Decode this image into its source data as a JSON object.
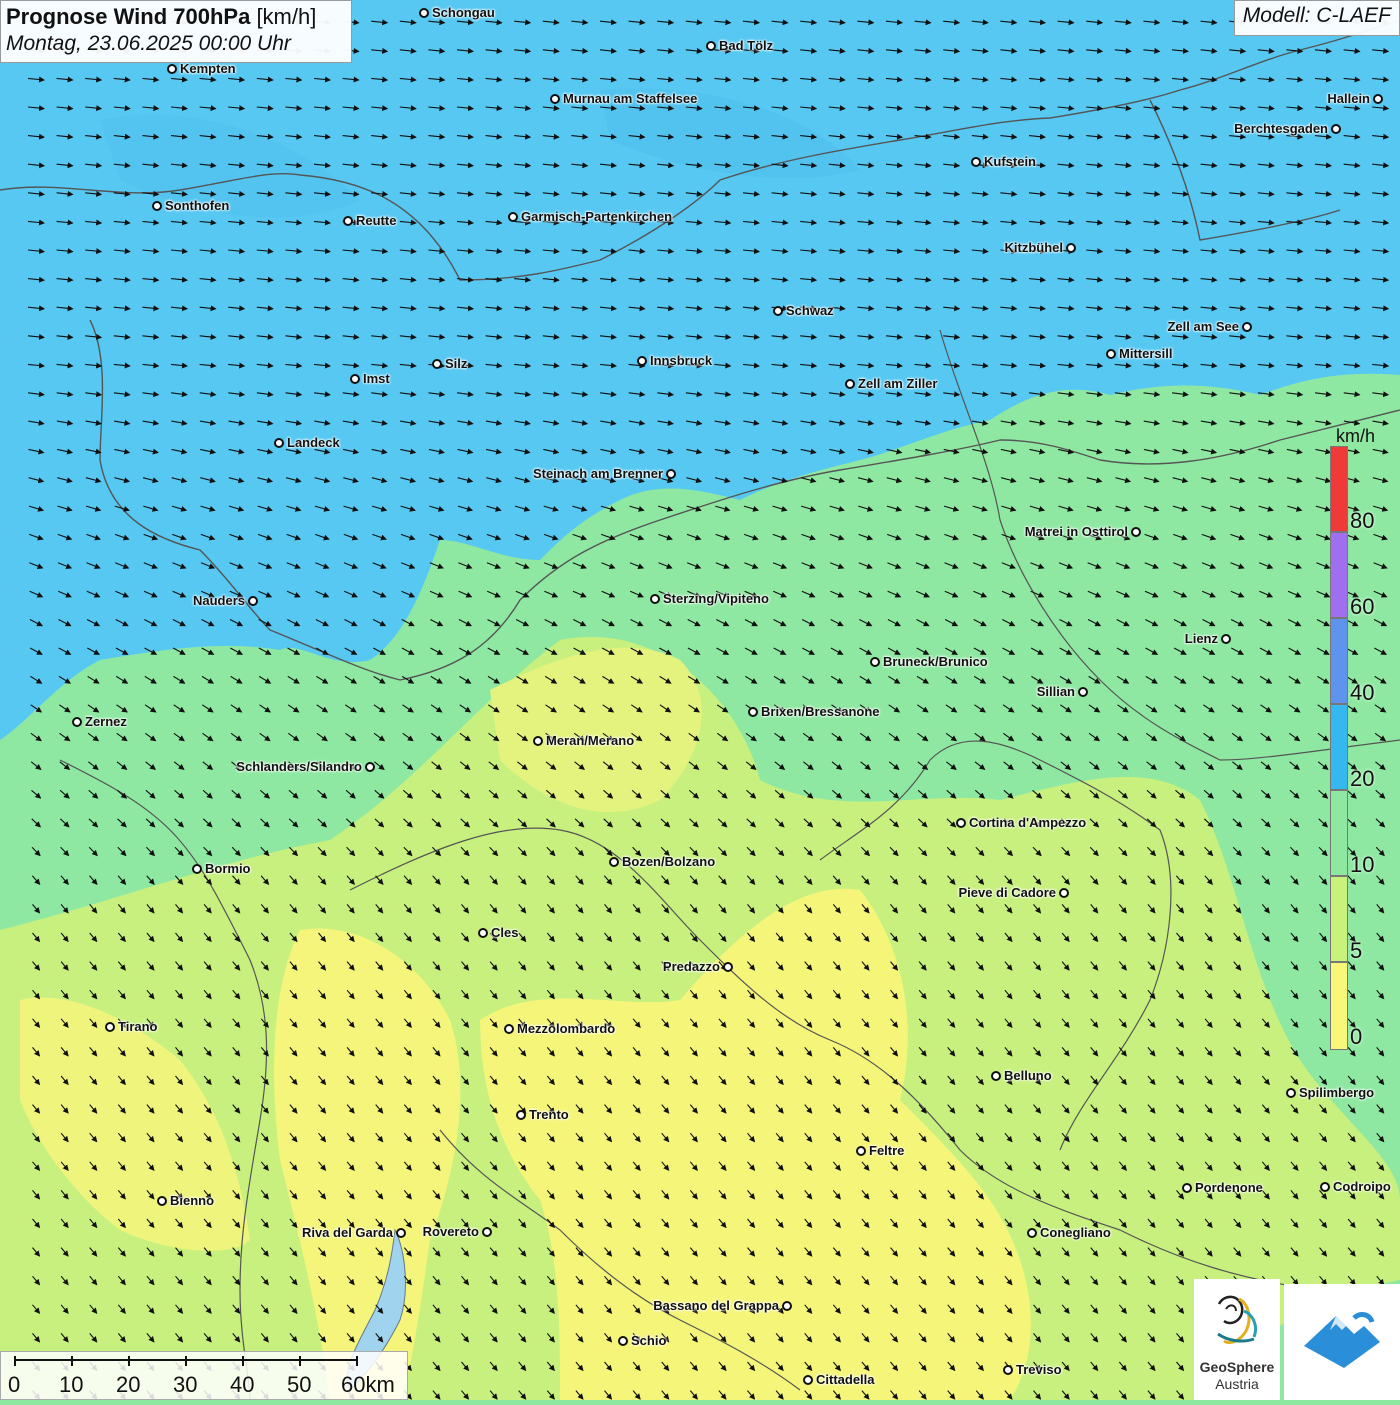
{
  "title": {
    "main_bold": "Prognose Wind 700hPa",
    "unit": "[km/h]",
    "datetime": "Montag, 23.06.2025 00:00 Uhr"
  },
  "model": "Modell: C-LAEF",
  "wind_arrow_direction": "WNW-NW wind; arrows point east in north, southeast in south",
  "colors": {
    "band_0_5": "#f7f77a",
    "band_5_10": "#c9f27c",
    "band_10_20": "#8fe8a2",
    "band_20_40": "#56c8f2",
    "band_40_60": "#5f94ee",
    "band_60_80": "#9f6ff0",
    "band_80_plus": "#f03a3a"
  },
  "legend": {
    "unit": "km/h",
    "ticks": [
      "80",
      "60",
      "40",
      "20",
      "10",
      "5",
      "0"
    ]
  },
  "scale": {
    "labels": [
      "0",
      "10",
      "20",
      "30",
      "40",
      "50",
      "60km"
    ]
  },
  "cities": [
    {
      "name": "Schongau"
    },
    {
      "name": "Bad Tölz"
    },
    {
      "name": "Kempten"
    },
    {
      "name": "Hallein"
    },
    {
      "name": "Murnau am Staffelsee"
    },
    {
      "name": "Berchtesgaden"
    },
    {
      "name": "Kufstein"
    },
    {
      "name": "Sonthofen"
    },
    {
      "name": "Reutte"
    },
    {
      "name": "Garmisch-Partenkirchen"
    },
    {
      "name": "Kitzbühel"
    },
    {
      "name": "Schwaz"
    },
    {
      "name": "Zell am See"
    },
    {
      "name": "Mittersill"
    },
    {
      "name": "Innsbruck"
    },
    {
      "name": "Silz"
    },
    {
      "name": "Imst"
    },
    {
      "name": "Zell am Ziller"
    },
    {
      "name": "Landeck"
    },
    {
      "name": "Steinach am Brenner"
    },
    {
      "name": "Matrei in Osttirol"
    },
    {
      "name": "Nauders"
    },
    {
      "name": "Sterzing/Vipiteno"
    },
    {
      "name": "Lienz"
    },
    {
      "name": "Bruneck/Brunico"
    },
    {
      "name": "Sillian"
    },
    {
      "name": "Brixen/Bressanone"
    },
    {
      "name": "Zernez"
    },
    {
      "name": "Meran/Merano"
    },
    {
      "name": "Schlanders/Silandro"
    },
    {
      "name": "Cortina d'Ampezzo"
    },
    {
      "name": "Bozen/Bolzano"
    },
    {
      "name": "Bormio"
    },
    {
      "name": "Pieve di Cadore"
    },
    {
      "name": "Cles"
    },
    {
      "name": "Predazzo"
    },
    {
      "name": "Tirano"
    },
    {
      "name": "Mezzolombardo"
    },
    {
      "name": "Belluno"
    },
    {
      "name": "Spilimbergo"
    },
    {
      "name": "Trento"
    },
    {
      "name": "Feltre"
    },
    {
      "name": "Pordenone"
    },
    {
      "name": "Codroipo"
    },
    {
      "name": "Bienno"
    },
    {
      "name": "Riva del Garda"
    },
    {
      "name": "Rovereto"
    },
    {
      "name": "Conegliano"
    },
    {
      "name": "Bassano del Grappa"
    },
    {
      "name": "Schio"
    },
    {
      "name": "Treviso"
    },
    {
      "name": "Cittadella"
    }
  ],
  "logo": {
    "name": "GeoSphere",
    "sub": "Austria"
  }
}
